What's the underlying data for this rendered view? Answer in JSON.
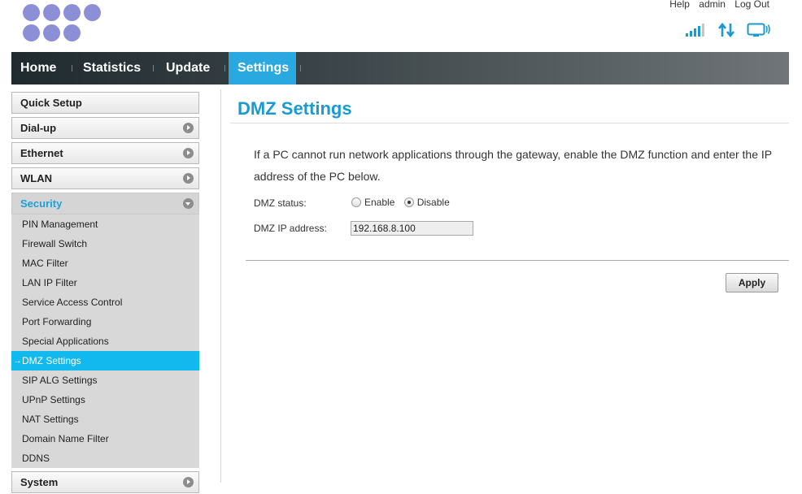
{
  "header": {
    "links": [
      "Help",
      "admin",
      "Log Out"
    ]
  },
  "status_icons": [
    "signal-strength-icon",
    "data-transfer-icon",
    "device-connected-icon"
  ],
  "nav": {
    "items": [
      {
        "label": "Home",
        "active": false
      },
      {
        "label": "Statistics",
        "active": false
      },
      {
        "label": "Update",
        "active": false
      },
      {
        "label": "Settings",
        "active": true
      }
    ]
  },
  "sidebar": {
    "quick_setup": "Quick Setup",
    "dialup": "Dial-up",
    "ethernet": "Ethernet",
    "wlan": "WLAN",
    "security": "Security",
    "security_items": [
      "PIN Management",
      "Firewall Switch",
      "MAC Filter",
      "LAN IP Filter",
      "Service Access Control",
      "Port Forwarding",
      "Special Applications",
      "DMZ Settings",
      "SIP ALG Settings",
      "UPnP Settings",
      "NAT Settings",
      "Domain Name Filter",
      "DDNS"
    ],
    "active_item": "DMZ Settings",
    "system": "System"
  },
  "main": {
    "title": "DMZ Settings",
    "description": "If a PC cannot run network applications through the gateway, enable the DMZ function and enter the IP address of the PC below.",
    "dmz_status_label": "DMZ status:",
    "enable_label": "Enable",
    "disable_label": "Disable",
    "dmz_status_value": "Disable",
    "dmz_ip_label": "DMZ IP address:",
    "dmz_ip_value": "192.168.8.100",
    "apply_label": "Apply"
  },
  "colors": {
    "accent": "#29a9df",
    "title": "#1b9ad2",
    "logo": "#8c8fd6"
  }
}
